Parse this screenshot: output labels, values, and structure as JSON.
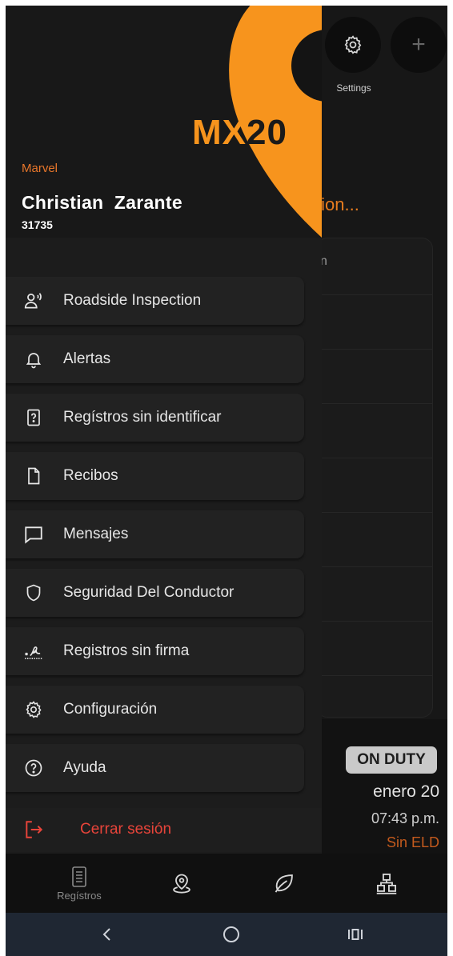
{
  "background": {
    "settings_label": "Settings",
    "title_fragment": "tion...",
    "card_fragment": "n",
    "duty_status": "ON DUTY",
    "date": "enero 20",
    "time": "07:43 p.m.",
    "eld_status": "Sin ELD"
  },
  "drawer": {
    "logo_prefix": "MX",
    "logo_suffix": "20",
    "company": "Marvel",
    "driver_name": "Christian  Zarante",
    "driver_id": "31735",
    "menu_items": [
      {
        "label": "Roadside Inspection",
        "icon": "inspector-icon"
      },
      {
        "label": "Alertas",
        "icon": "bell-icon"
      },
      {
        "label": "Regístros sin identificar",
        "icon": "unknown-record-icon"
      },
      {
        "label": "Recibos",
        "icon": "document-icon"
      },
      {
        "label": "Mensajes",
        "icon": "chat-icon"
      },
      {
        "label": "Seguridad Del Conductor",
        "icon": "shield-icon"
      },
      {
        "label": "Registros sin firma",
        "icon": "signature-icon"
      },
      {
        "label": "Configuración",
        "icon": "gear-icon"
      },
      {
        "label": "Ayuda",
        "icon": "help-icon"
      }
    ],
    "logout_label": "Cerrar sesión"
  },
  "bottom_nav": {
    "items": [
      {
        "label": "Regístros",
        "icon": "logbook-icon"
      },
      {
        "label": "",
        "icon": "location-icon"
      },
      {
        "label": "",
        "icon": "leaf-icon"
      },
      {
        "label": "",
        "icon": "hierarchy-icon"
      }
    ]
  },
  "colors": {
    "accent": "#f7941d",
    "company_text": "#e8762a",
    "logout": "#e8443a",
    "drawer_bg": "#1c1c1c",
    "menu_item_bg": "#222222"
  }
}
